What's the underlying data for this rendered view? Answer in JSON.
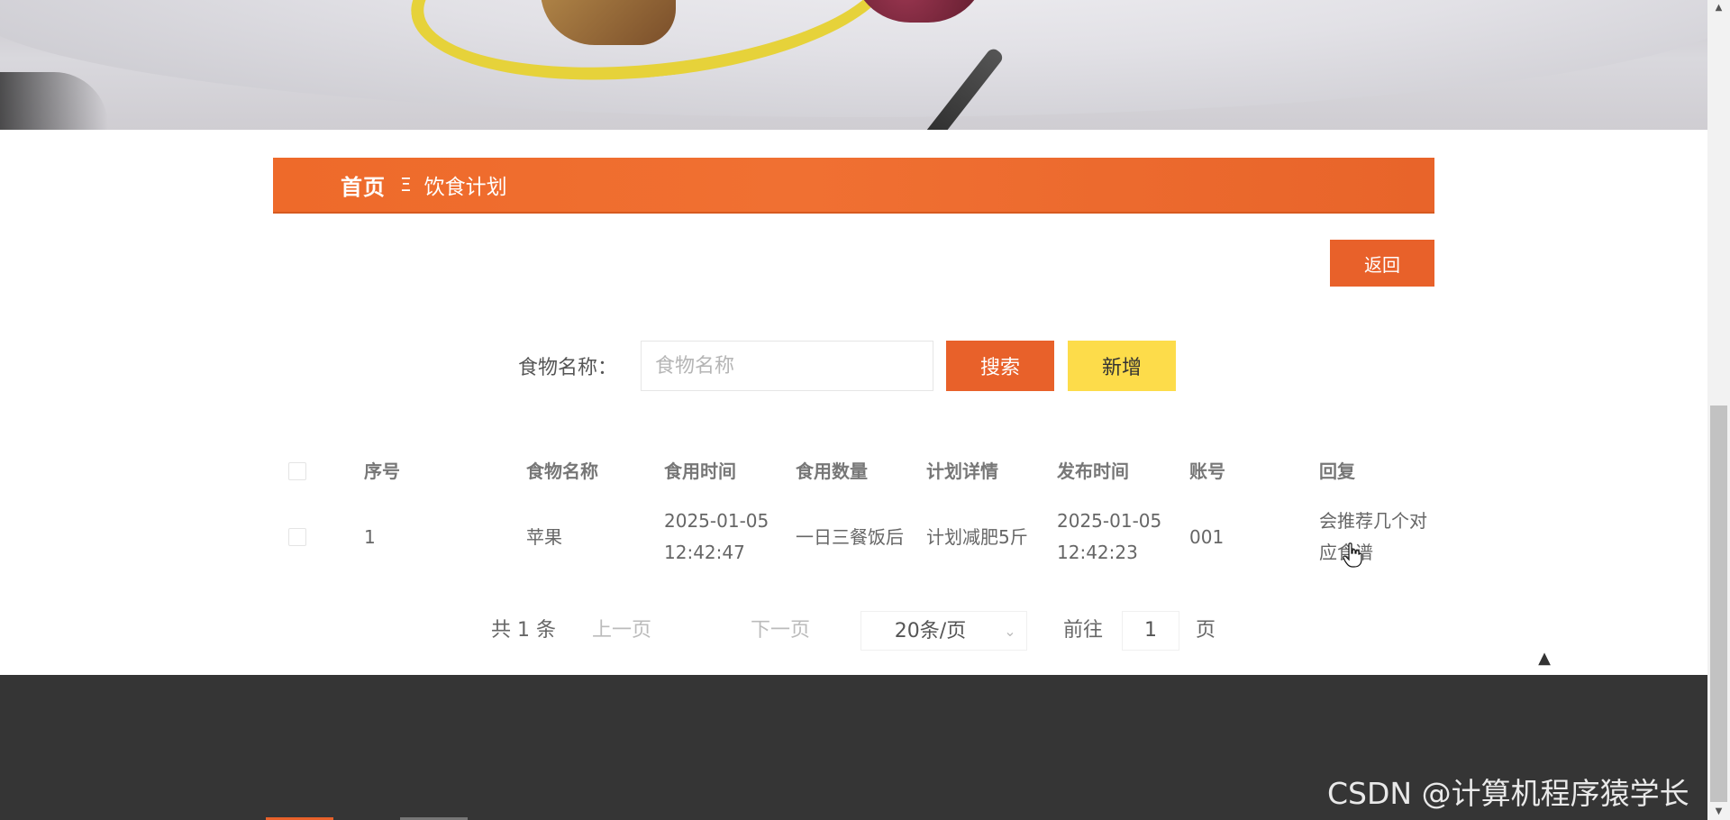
{
  "breadcrumb": {
    "home": "首页",
    "separator": "Ξ",
    "current": "饮食计划"
  },
  "actions": {
    "back_label": "返回"
  },
  "search": {
    "label": "食物名称：",
    "placeholder": "食物名称",
    "search_label": "搜索",
    "add_label": "新增"
  },
  "table": {
    "columns": [
      "序号",
      "食物名称",
      "食用时间",
      "食用数量",
      "计划详情",
      "发布时间",
      "账号",
      "回复"
    ],
    "rows": [
      {
        "index": "1",
        "food": "苹果",
        "eat_time": "2025-01-05 12:42:47",
        "amount": "一日三餐饭后",
        "detail": "计划减肥5斤",
        "published": "2025-01-05 12:42:23",
        "account": "001",
        "reply": "会推荐几个对应食谱"
      }
    ]
  },
  "pagination": {
    "total": "共 1 条",
    "prev": "上一页",
    "next": "下一页",
    "page_size": "20条/页",
    "goto_label": "前往",
    "goto_value": "1",
    "goto_unit": "页"
  },
  "watermark": "CSDN @计算机程序猿学长",
  "colors": {
    "accent": "#e8612a",
    "add_button": "#fddc4a",
    "footer": "#353535"
  },
  "icons": {
    "back_to_top": "caret-up-icon",
    "page_size_dropdown": "chevron-down-icon"
  }
}
